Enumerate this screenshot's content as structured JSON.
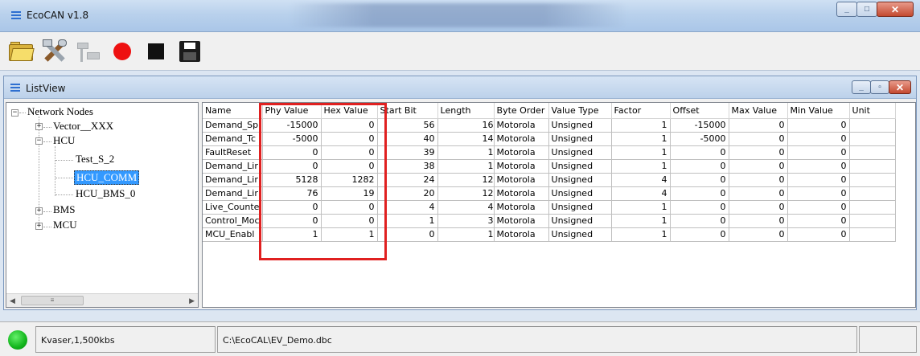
{
  "window": {
    "title": "EcoCAN v1.8"
  },
  "toolbar": {
    "buttons": [
      {
        "icon": "open-folder-icon"
      },
      {
        "icon": "tools-icon"
      },
      {
        "icon": "connect-plug-icon"
      },
      {
        "icon": "record-icon"
      },
      {
        "icon": "stop-icon"
      },
      {
        "icon": "save-icon"
      }
    ]
  },
  "listview": {
    "title": "ListView",
    "tree": {
      "root": "Network Nodes",
      "nodes": [
        "Vector__XXX",
        "HCU",
        "Test_S_2",
        "HCU_COMM",
        "HCU_BMS_0",
        "BMS",
        "MCU"
      ]
    },
    "grid": {
      "columns": [
        "Name",
        "Phy Value",
        "Hex Value",
        "Start Bit",
        "Length",
        "Byte Order",
        "Value Type",
        "Factor",
        "Offset",
        "Max Value",
        "Min Value",
        "Unit"
      ],
      "rows": [
        [
          "Demand_Sp",
          "-15000",
          "0",
          "56",
          "16",
          "Motorola",
          "Unsigned",
          "1",
          "-15000",
          "0",
          "0",
          ""
        ],
        [
          "Demand_Tc",
          "-5000",
          "0",
          "40",
          "14",
          "Motorola",
          "Unsigned",
          "1",
          "-5000",
          "0",
          "0",
          ""
        ],
        [
          "FaultReset",
          "0",
          "0",
          "39",
          "1",
          "Motorola",
          "Unsigned",
          "1",
          "0",
          "0",
          "0",
          ""
        ],
        [
          "Demand_Lir",
          "0",
          "0",
          "38",
          "1",
          "Motorola",
          "Unsigned",
          "1",
          "0",
          "0",
          "0",
          ""
        ],
        [
          "Demand_Lir",
          "5128",
          "1282",
          "24",
          "12",
          "Motorola",
          "Unsigned",
          "4",
          "0",
          "0",
          "0",
          ""
        ],
        [
          "Demand_Lir",
          "76",
          "19",
          "20",
          "12",
          "Motorola",
          "Unsigned",
          "4",
          "0",
          "0",
          "0",
          ""
        ],
        [
          "Live_Counte",
          "0",
          "0",
          "4",
          "4",
          "Motorola",
          "Unsigned",
          "1",
          "0",
          "0",
          "0",
          ""
        ],
        [
          "Control_Moc",
          "0",
          "0",
          "1",
          "3",
          "Motorola",
          "Unsigned",
          "1",
          "0",
          "0",
          "0",
          ""
        ],
        [
          "MCU_Enabl",
          "1",
          "1",
          "0",
          "1",
          "Motorola",
          "Unsigned",
          "1",
          "0",
          "0",
          "0",
          ""
        ]
      ]
    }
  },
  "status": {
    "connection": "Kvaser,1,500kbs",
    "file": "C:\\EcoCAL\\EV_Demo.dbc",
    "led_color": "#16b81f"
  },
  "colors": {
    "highlight": "#e02020",
    "selection": "#3399ff"
  }
}
